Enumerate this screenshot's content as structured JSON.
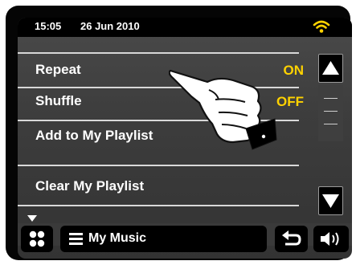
{
  "status": {
    "time": "15:05",
    "date": "26 Jun 2010"
  },
  "icons": {
    "wifi": "wifi-signal-icon",
    "scroll_up": "triangle-up-icon",
    "scroll_down": "triangle-down-icon",
    "more": "triangle-down-small-icon",
    "home": "four-dots-menu-icon",
    "list": "hamburger-list-icon",
    "back": "return-arrow-icon",
    "volume": "speaker-volume-icon",
    "pointer": "pointing-hand-icon"
  },
  "menu": [
    {
      "label": "Repeat",
      "value": "ON"
    },
    {
      "label": "Shuffle",
      "value": "OFF"
    },
    {
      "label": "Add to My Playlist",
      "value": ""
    },
    {
      "label": "Clear My Playlist",
      "value": ""
    }
  ],
  "bottom": {
    "source_label": "My Music"
  },
  "colors": {
    "accent_value": "#ffd200",
    "wifi": "#ffd200",
    "screen": "#444444",
    "bezel": "#050505"
  }
}
